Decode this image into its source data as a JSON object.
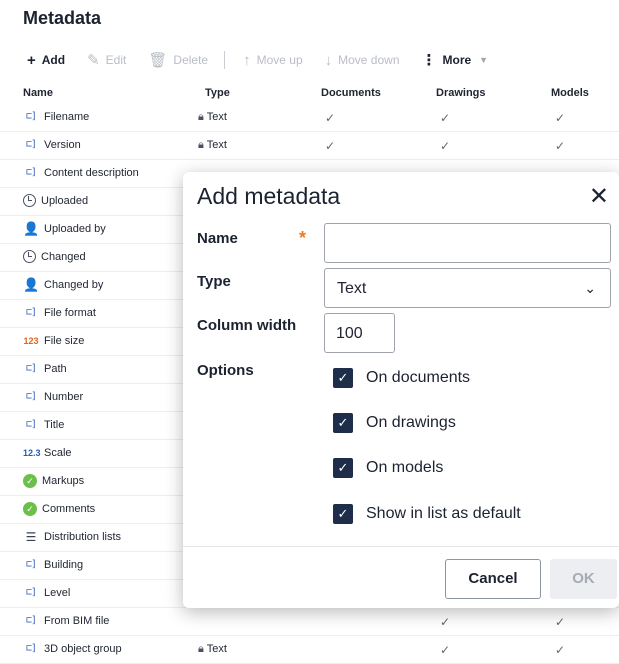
{
  "page": {
    "title": "Metadata"
  },
  "toolbar": {
    "add": "Add",
    "add_icon": "plus-icon",
    "edit": "Edit",
    "edit_icon": "pencil-icon",
    "delete": "Delete",
    "delete_icon": "trash-icon",
    "move_up": "Move up",
    "move_up_icon": "arrow-up-icon",
    "move_down": "Move down",
    "move_down_icon": "arrow-down-icon",
    "more": "More",
    "more_icon": "kebab-icon"
  },
  "table": {
    "columns": {
      "name": "Name",
      "type": "Type",
      "documents": "Documents",
      "drawings": "Drawings",
      "models": "Models"
    },
    "rows": [
      {
        "name": "Filename",
        "icon": "field-icon",
        "type": "Text",
        "documents": true,
        "drawings": true,
        "models": true
      },
      {
        "name": "Version",
        "icon": "field-icon",
        "type": "Text",
        "documents": true,
        "drawings": true,
        "models": true
      },
      {
        "name": "Content description",
        "icon": "field-icon"
      },
      {
        "name": "Uploaded",
        "icon": "clock-icon"
      },
      {
        "name": "Uploaded by",
        "icon": "user-icon"
      },
      {
        "name": "Changed",
        "icon": "clock-icon"
      },
      {
        "name": "Changed by",
        "icon": "user-icon"
      },
      {
        "name": "File format",
        "icon": "field-icon"
      },
      {
        "name": "File size",
        "icon": "integer-icon"
      },
      {
        "name": "Path",
        "icon": "field-icon"
      },
      {
        "name": "Number",
        "icon": "field-icon"
      },
      {
        "name": "Title",
        "icon": "field-icon"
      },
      {
        "name": "Scale",
        "icon": "decimal-icon"
      },
      {
        "name": "Markups",
        "icon": "check-circle-icon"
      },
      {
        "name": "Comments",
        "icon": "check-circle-icon"
      },
      {
        "name": "Distribution lists",
        "icon": "list-icon"
      },
      {
        "name": "Building",
        "icon": "field-icon"
      },
      {
        "name": "Level",
        "icon": "field-icon"
      },
      {
        "name": "From BIM file",
        "icon": "field-icon",
        "drawings": true,
        "models": true
      },
      {
        "name": "3D object group",
        "icon": "field-icon",
        "type": "Text",
        "drawings": true,
        "models": true
      }
    ]
  },
  "icon_glyphs": {
    "integer": "123",
    "decimal": "12.3"
  },
  "modal": {
    "title": "Add metadata",
    "close_icon": "close-icon",
    "name_label": "Name",
    "name_value": "",
    "required_mark": "*",
    "type_label": "Type",
    "type_value": "Text",
    "column_width_label": "Column width",
    "column_width_value": "100",
    "options_label": "Options",
    "options": [
      {
        "label": "On documents",
        "checked": true
      },
      {
        "label": "On drawings",
        "checked": true
      },
      {
        "label": "On models",
        "checked": true
      },
      {
        "label": "Show in list as default",
        "checked": true
      }
    ],
    "cancel_label": "Cancel",
    "ok_label": "OK"
  },
  "colors": {
    "accent_dark": "#1e2e4a",
    "required": "#f07a1e",
    "status_green": "#6cc04a",
    "user_blue": "#2f86d8"
  }
}
